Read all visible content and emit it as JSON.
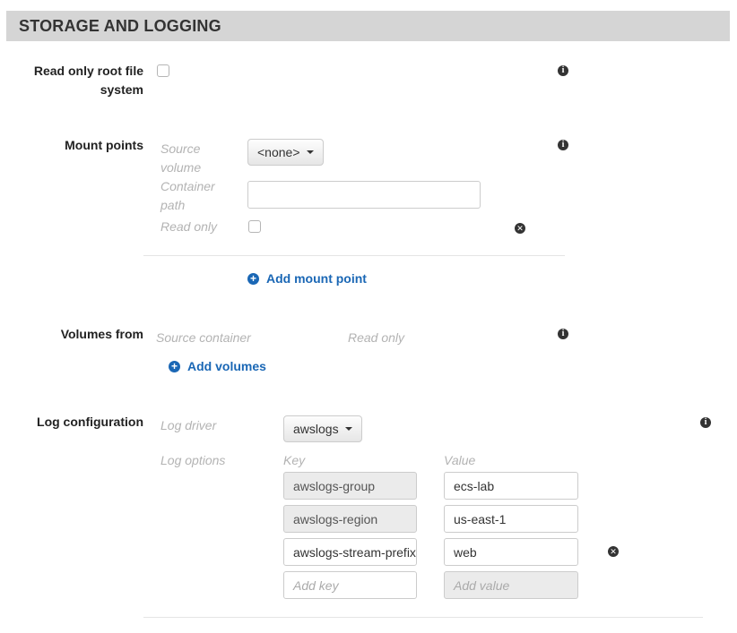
{
  "header": {
    "title": "STORAGE AND LOGGING"
  },
  "read_only_root": {
    "label": "Read only root file system"
  },
  "mount_points": {
    "label": "Mount points",
    "source_volume_label": "Source volume",
    "source_volume_value": "<none>",
    "container_path_label": "Container path",
    "container_path_value": "",
    "read_only_label": "Read only",
    "add_label": "Add mount point"
  },
  "volumes_from": {
    "label": "Volumes from",
    "source_container_label": "Source container",
    "read_only_label": "Read only",
    "add_label": "Add volumes"
  },
  "log_configuration": {
    "label": "Log configuration",
    "log_driver_label": "Log driver",
    "log_driver_value": "awslogs",
    "log_options_label": "Log options",
    "key_header": "Key",
    "value_header": "Value",
    "options": [
      {
        "key": "awslogs-group",
        "value": "ecs-lab"
      },
      {
        "key": "awslogs-region",
        "value": "us-east-1"
      },
      {
        "key": "awslogs-stream-prefix",
        "value": "web"
      }
    ],
    "add_key_placeholder": "Add key",
    "add_value_placeholder": "Add value"
  },
  "icons": {
    "info": "info-icon",
    "remove": "remove-icon",
    "add": "plus-circle-icon",
    "checkbox": "checkbox"
  },
  "colors": {
    "header_bg": "#d5d5d5",
    "link": "#1a67b5",
    "muted": "#b3b3b3"
  }
}
